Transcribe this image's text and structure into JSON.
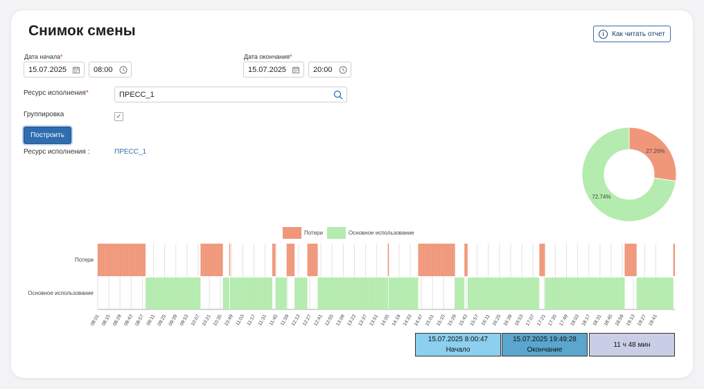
{
  "page": {
    "title": "Снимок смены",
    "help_button": "Как читать отчет"
  },
  "form": {
    "start": {
      "label": "Дата начала",
      "date": "15.07.2025",
      "time": "08:00"
    },
    "end": {
      "label": "Дата окончания",
      "date": "15.07.2025",
      "time": "20:00"
    },
    "resource": {
      "label": "Ресурс исполнения",
      "value": "ПРЕСС_1"
    },
    "grouping": {
      "label": "Группировка",
      "checked": true
    },
    "build_button": "Построить"
  },
  "result": {
    "resource_label": "Ресурс исполнения :",
    "resource_value": "ПРЕСС_1"
  },
  "colors": {
    "loss": "#f0977a",
    "main": "#b4ebae",
    "accent": "#2e6db0"
  },
  "chart_data": [
    {
      "type": "pie",
      "variant": "donut",
      "slices": [
        {
          "name": "Потери",
          "value": 27.26,
          "label": "27.26%"
        },
        {
          "name": "Основное использование",
          "value": 72.74,
          "label": "72.74%"
        }
      ]
    },
    {
      "type": "heatmap",
      "legend": [
        "Потери",
        "Основное использование"
      ],
      "rows": [
        "Потери",
        "Основное использование"
      ],
      "time_ticks": [
        "08:01",
        "08:15",
        "08:29",
        "08:43",
        "08:57",
        "09:11",
        "09:25",
        "09:39",
        "09:53",
        "10:07",
        "10:21",
        "10:35",
        "10:49",
        "11:03",
        "11:17",
        "11:31",
        "11:45",
        "11:59",
        "12:13",
        "12:27",
        "12:41",
        "12:55",
        "13:09",
        "13:23",
        "13:37",
        "13:51",
        "14:05",
        "14:19",
        "14:33",
        "14:47",
        "15:01",
        "15:15",
        "15:29",
        "15:43",
        "15:57",
        "16:11",
        "16:25",
        "16:39",
        "16:53",
        "17:07",
        "17:21",
        "17:35",
        "17:49",
        "18:03",
        "18:17",
        "18:31",
        "18:45",
        "18:59",
        "19:13",
        "19:27",
        "19:41"
      ],
      "loss_intervals": [
        [
          "08:01",
          "09:01"
        ],
        [
          "10:10",
          "10:38"
        ],
        [
          "10:46",
          "10:47"
        ],
        [
          "11:40",
          "11:44"
        ],
        [
          "11:58",
          "12:08"
        ],
        [
          "12:24",
          "12:37"
        ],
        [
          "14:05",
          "14:06"
        ],
        [
          "14:43",
          "15:29"
        ],
        [
          "15:41",
          "15:45"
        ],
        [
          "17:15",
          "17:22"
        ],
        [
          "19:02",
          "19:17"
        ],
        [
          "20:03",
          "20:05"
        ]
      ],
      "main_intervals": [
        [
          "09:01",
          "10:10"
        ],
        [
          "10:38",
          "10:46"
        ],
        [
          "10:47",
          "11:40"
        ],
        [
          "11:44",
          "11:58"
        ],
        [
          "12:08",
          "12:24"
        ],
        [
          "12:37",
          "14:05"
        ],
        [
          "14:06",
          "14:43"
        ],
        [
          "15:29",
          "15:41"
        ],
        [
          "15:45",
          "17:15"
        ],
        [
          "17:22",
          "19:02"
        ],
        [
          "19:17",
          "20:03"
        ]
      ]
    }
  ],
  "summary": {
    "start": {
      "datetime": "15.07.2025 8:00:47",
      "label": "Начало",
      "color": "#8ccfee"
    },
    "end": {
      "datetime": "15.07.2025 19:49:28",
      "label": "Окончание",
      "color": "#5aa6cd"
    },
    "duration": {
      "value": "11 ч 48 мин",
      "color": "#c9cde6"
    }
  }
}
